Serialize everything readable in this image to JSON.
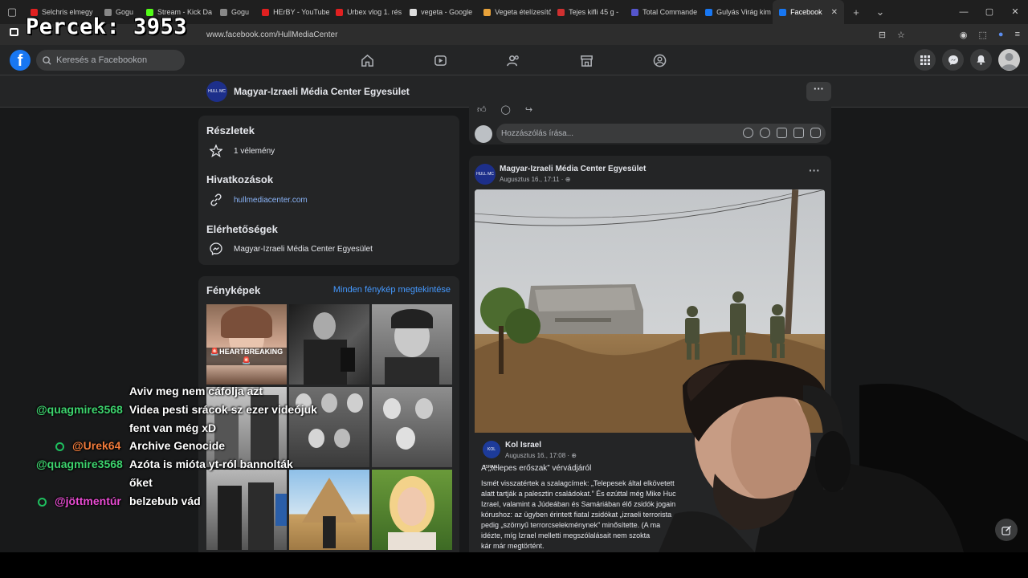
{
  "browser": {
    "tabs": [
      {
        "label": "Selchris elmegy",
        "color": "#e02020"
      },
      {
        "label": "Gogu",
        "color": "#888888"
      },
      {
        "label": "Stream - Kick Da",
        "color": "#53fc18"
      },
      {
        "label": "Gogu",
        "color": "#888888"
      },
      {
        "label": "HErBY - YouTube",
        "color": "#e02020"
      },
      {
        "label": "Urbex vlog 1. rés",
        "color": "#e02020"
      },
      {
        "label": "vegeta - Google",
        "color": "#dddddd"
      },
      {
        "label": "Vegeta ételízesítő",
        "color": "#e8a23a"
      },
      {
        "label": "Tejes kifli 45 g -",
        "color": "#d03030"
      },
      {
        "label": "Total Commande",
        "color": "#5555cc"
      },
      {
        "label": "Gulyás Virág kim",
        "color": "#1877f2"
      },
      {
        "label": "Facebook",
        "color": "#1877f2"
      }
    ],
    "url": "www.facebook.com/HullMediaCenter"
  },
  "overlay": {
    "counter": "Percek: 3953"
  },
  "fb": {
    "search_placeholder": "Keresés a Facebookon",
    "logo": "f"
  },
  "page": {
    "title": "Magyar-Izraeli Média Center Egyesület",
    "logo_text": "HULL MC",
    "details_title": "Részletek",
    "reviews": "1 vélemény",
    "links_title": "Hivatkozások",
    "website": "hullmediacenter.com",
    "contacts_title": "Elérhetőségek",
    "messenger_name": "Magyar-Izraeli Média Center Egyesület",
    "photos_title": "Fényképek",
    "photos_link": "Minden fénykép megtekintése",
    "photo_caption": "🚨HEARTBREAKING🚨"
  },
  "comment": {
    "placeholder": "Hozzászólás írása..."
  },
  "post": {
    "author": "Magyar-Izraeli Média Center Egyesület",
    "meta": "Augusztus 16., 17:11 · ",
    "shared_author": "Kol Israel",
    "shared_meta": "Augusztus 16., 17:08 · ",
    "shared_logo": "KOL ISRAEL",
    "headline": "A „telepes erőszak” vérvádjáról",
    "body": "Ismét visszatértek a szalagcímek: „Telepesek által elkövetett\nalatt tartják a palesztin családokat.” És ezúttal még Mike Huc\nIzrael, valamint a Júdeában és Samáriában élő zsidók jogain\nkórushoz: az ügyben érintett fiatal zsidókat „izraeli terrorista\npedig „szörnyű terrorcselekménynek” minősítette. (A ma\nidézte, míg Izrael melletti megszólalásait nem szokta\nkár már megtörtént."
  },
  "chat": [
    {
      "user": "",
      "msg": "Aviv meg nem cáfolja azt",
      "user_color": "green"
    },
    {
      "user": "@quagmire3568",
      "msg": "Videa pesti srácok sz ezer videójuk",
      "user_color": "green"
    },
    {
      "user": "",
      "msg": "fent van még xD",
      "user_color": "green"
    },
    {
      "user": "@Urek64",
      "msg": "Archive Genocide",
      "user_color": "orange",
      "badge": true
    },
    {
      "user": "@quagmire3568",
      "msg": "Azóta is mióta yt-ról bannolták",
      "user_color": "green"
    },
    {
      "user": "",
      "msg": "őket",
      "user_color": "green"
    },
    {
      "user": "@jöttmentúr",
      "msg": "belzebub vád",
      "user_color": "pink",
      "badge": true
    }
  ],
  "colors": {
    "fb_blue": "#1877f2",
    "fb_dark": "#18191a",
    "fb_card": "#242526",
    "link": "#4599ff"
  }
}
